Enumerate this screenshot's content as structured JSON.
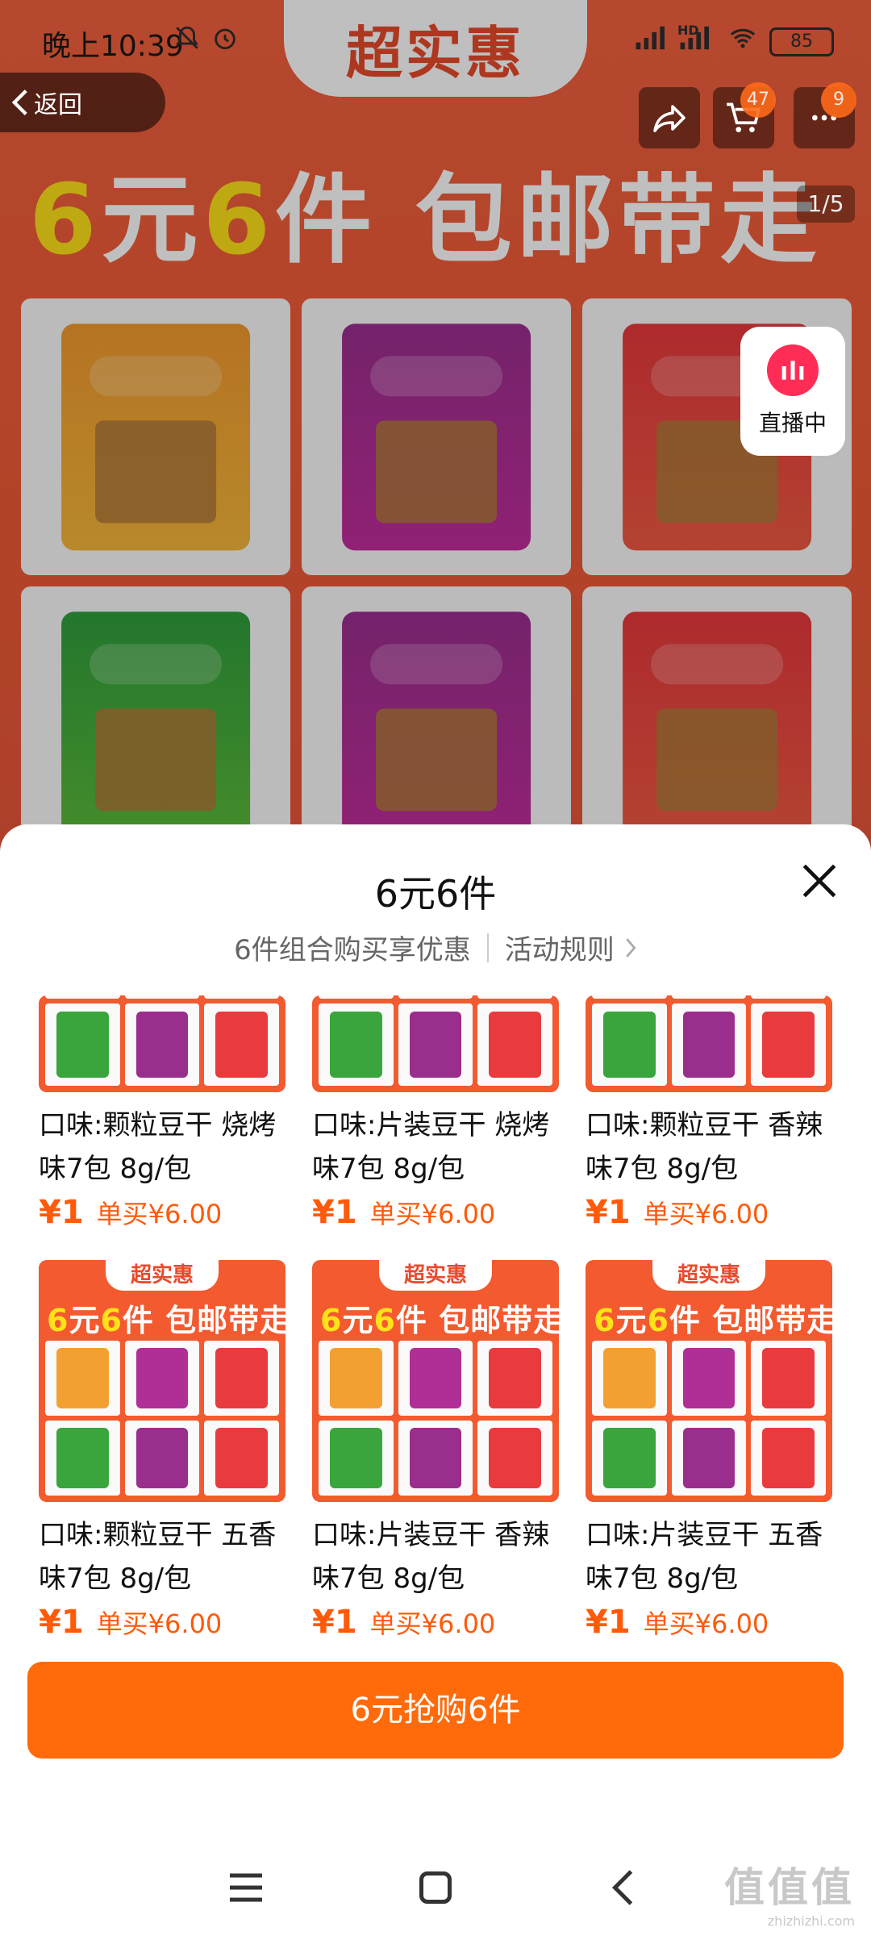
{
  "status_bar": {
    "time": "晚上10:39",
    "hd_label": "HD",
    "battery": "85"
  },
  "nav": {
    "back_label": "返回",
    "cart_badge": "47",
    "more_badge": "9",
    "pager": "1/5",
    "live_label": "直播中"
  },
  "banner": {
    "tag": "超实惠",
    "slogan_highlight_1": "6",
    "slogan_text_1": "元",
    "slogan_highlight_2": "6",
    "slogan_text_2": "件 包邮带走"
  },
  "sheet": {
    "title": "6元6件",
    "subtitle": "6件组合购买享优惠",
    "rules_link": "活动规则",
    "items": [
      {
        "name": "口味:颗粒豆干 烧烤味7包 8g/包",
        "price": "¥1",
        "single": "单买¥6.00"
      },
      {
        "name": "口味:片装豆干 烧烤味7包 8g/包",
        "price": "¥1",
        "single": "单买¥6.00"
      },
      {
        "name": "口味:颗粒豆干 香辣味7包 8g/包",
        "price": "¥1",
        "single": "单买¥6.00"
      },
      {
        "name": "口味:颗粒豆干 五香味7包 8g/包",
        "price": "¥1",
        "single": "单买¥6.00"
      },
      {
        "name": "口味:片装豆干 香辣味7包 8g/包",
        "price": "¥1",
        "single": "单买¥6.00"
      },
      {
        "name": "口味:片装豆干 五香味7包 8g/包",
        "price": "¥1",
        "single": "单买¥6.00"
      }
    ],
    "buy_button": "6元抢购6件"
  },
  "thumb": {
    "tag": "超实惠",
    "slogan_hl_1": "6",
    "slogan_1": "元",
    "slogan_hl_2": "6",
    "slogan_2": "件 包邮带走"
  },
  "watermark": {
    "main": "值值值",
    "sub": "zhizhizhi.com"
  },
  "colors": {
    "accent": "#ff6a0a",
    "banner": "#f2603e",
    "price": "#ff5a0a"
  }
}
